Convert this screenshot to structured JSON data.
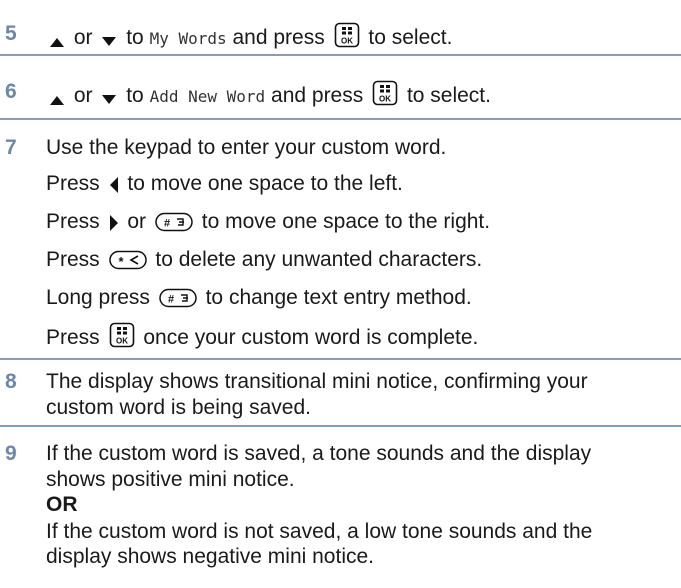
{
  "step5": {
    "number": "5",
    "or": "or",
    "to": "to",
    "menu_item": "My Words",
    "and_press": "and press",
    "to_select": "to select."
  },
  "step6": {
    "number": "6",
    "or": "or",
    "to": "to",
    "menu_item": "Add New Word",
    "and_press": "and press",
    "to_select": "to select."
  },
  "step7": {
    "number": "7",
    "line1": "Use the keypad to enter your custom word.",
    "line2_pre": "Press",
    "line2_post": "to move one space to the left.",
    "line3_pre": "Press",
    "line3_or": "or",
    "line3_post": "to move one space to the right.",
    "line4_pre": "Press",
    "line4_post": "to delete any unwanted characters.",
    "line5_pre": "Long press",
    "line5_post": "to change text entry method.",
    "line6_pre": "Press",
    "line6_post": "once your custom word is complete."
  },
  "step8": {
    "number": "8",
    "line1": "The display shows transitional mini notice, confirming your",
    "line2": "custom word is being saved."
  },
  "step9": {
    "number": "9",
    "line1": "If the custom word is saved, a tone sounds and the display",
    "line2": "shows positive mini notice.",
    "or_label": "OR",
    "line3": "If the custom word is not saved, a low tone sounds and the",
    "line4": "display shows negative mini notice."
  },
  "icons": {
    "up": "up-arrow-key-icon",
    "down": "down-arrow-key-icon",
    "ok": "menu-ok-key-icon",
    "left": "left-arrow-key-icon",
    "right": "right-arrow-key-icon",
    "hash": "hash-key-icon",
    "star": "star-key-icon"
  },
  "colors": {
    "step_number": "#6e86a8",
    "rule": "#8a9cb5",
    "text": "#1a1a1a"
  }
}
